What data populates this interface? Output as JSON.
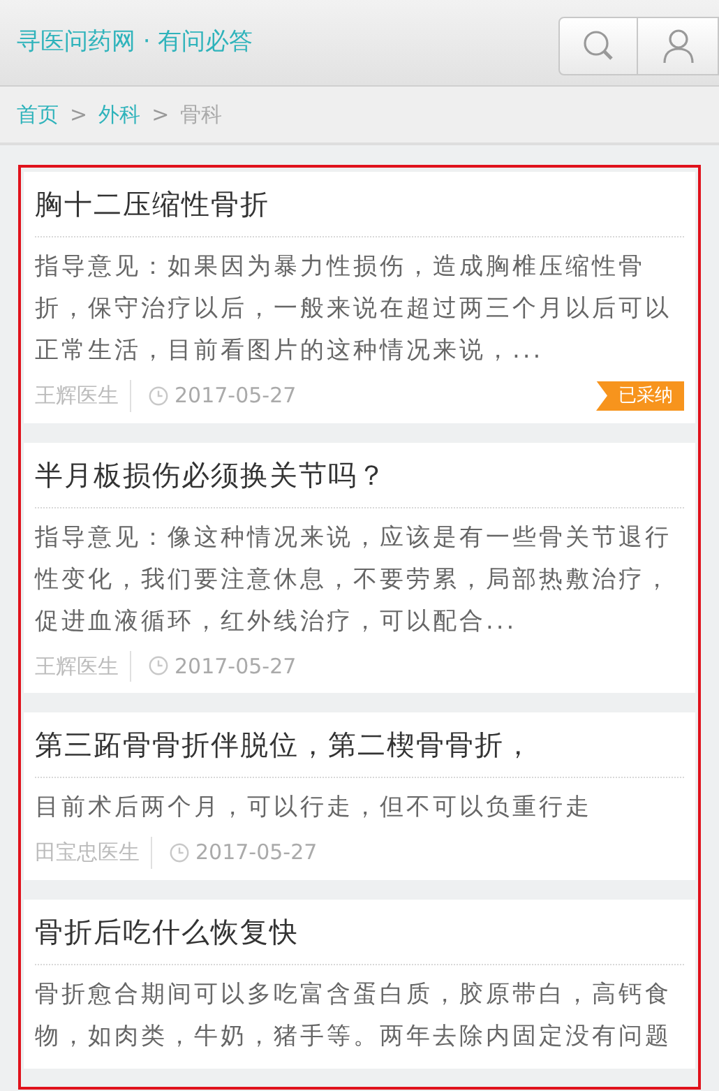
{
  "header": {
    "title": "寻医问药网 · 有问必答"
  },
  "breadcrumb": [
    {
      "label": "首页",
      "current": false
    },
    {
      "label": "外科",
      "current": false
    },
    {
      "label": "骨科",
      "current": true
    }
  ],
  "breadcrumb_separator": ">",
  "questions": [
    {
      "title": "胸十二压缩性骨折",
      "answer": "指导意见：如果因为暴力性损伤，造成胸椎压缩性骨折，保守治疗以后，一般来说在超过两三个月以后可以正常生活，目前看图片的这种情况来说，...",
      "doctor": "王辉医生",
      "date": "2017-05-27",
      "adopted": true,
      "badge": "已采纳"
    },
    {
      "title": "半月板损伤必须换关节吗？",
      "answer": "指导意见：像这种情况来说，应该是有一些骨关节退行性变化，我们要注意休息，不要劳累，局部热敷治疗，促进血液循环，红外线治疗，可以配合...",
      "doctor": "王辉医生",
      "date": "2017-05-27",
      "adopted": false
    },
    {
      "title": "第三跖骨骨折伴脱位，第二楔骨骨折，",
      "answer": "目前术后两个月，可以行走，但不可以负重行走",
      "doctor": "田宝忠医生",
      "date": "2017-05-27",
      "adopted": false
    },
    {
      "title": "骨折后吃什么恢复快",
      "answer": "骨折愈合期间可以多吃富含蛋白质，胶原带白，高钙食物，如肉类，牛奶，猪手等。两年去除内固定没有问题"
    }
  ]
}
